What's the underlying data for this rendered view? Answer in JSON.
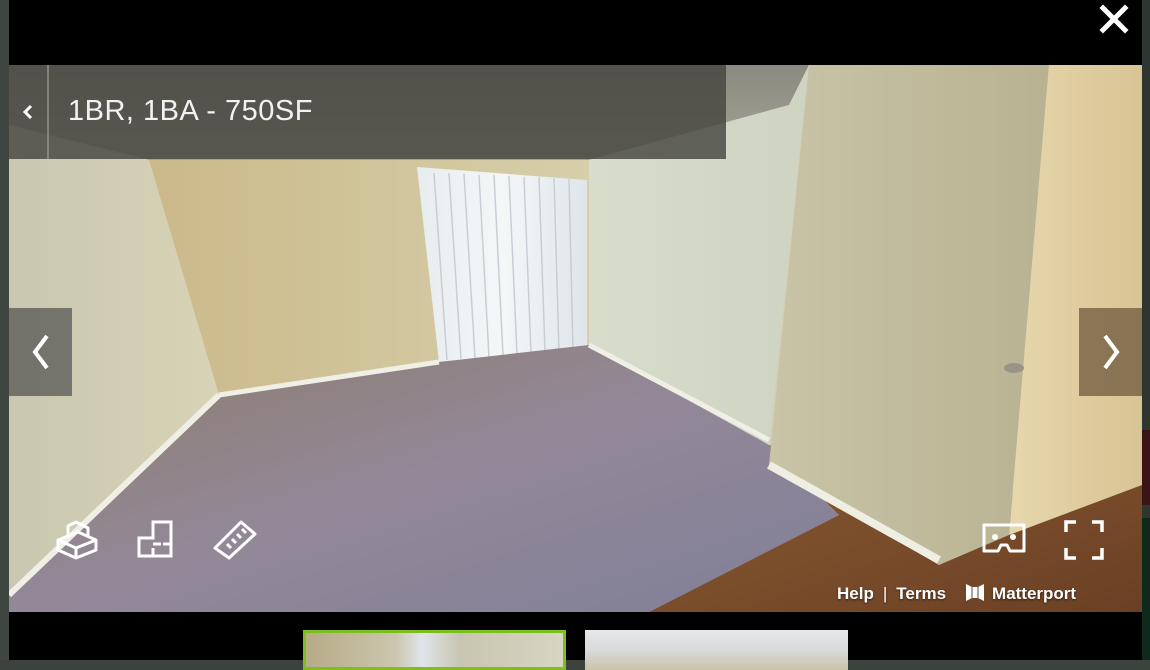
{
  "modal": {
    "close_icon": "close-icon"
  },
  "viewer": {
    "title": "1BR, 1BA - 750SF",
    "back_icon": "chevron-left-icon",
    "prev_icon": "chevron-left-icon",
    "next_icon": "chevron-right-icon",
    "tools": [
      {
        "name": "dollhouse-view",
        "icon": "dollhouse-icon"
      },
      {
        "name": "floorplan-view",
        "icon": "floorplan-icon"
      },
      {
        "name": "measure",
        "icon": "ruler-icon"
      },
      {
        "name": "vr-mode",
        "icon": "vr-headset-icon"
      },
      {
        "name": "fullscreen",
        "icon": "fullscreen-icon"
      }
    ],
    "footer": {
      "help_label": "Help",
      "separator": "|",
      "terms_label": "Terms",
      "brand_label": "Matterport"
    }
  },
  "thumbnails": [
    {
      "name": "thumbnail-1",
      "selected": true
    },
    {
      "name": "thumbnail-2",
      "selected": false
    }
  ],
  "colors": {
    "selected_thumbnail_border": "#7cbf1e",
    "modal_background": "#000000"
  }
}
